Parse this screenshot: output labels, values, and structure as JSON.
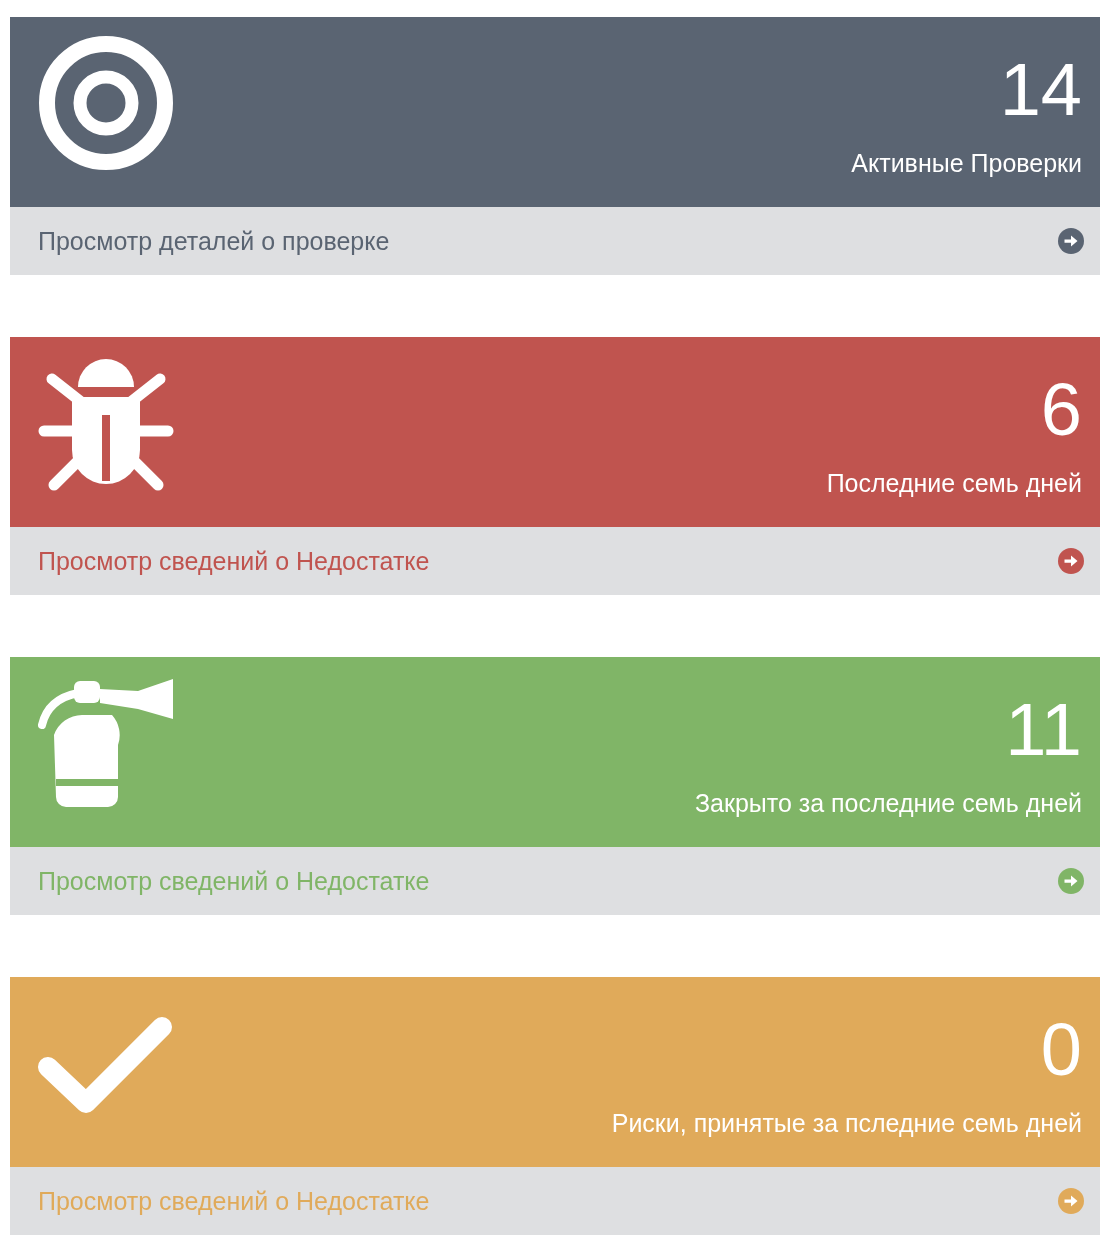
{
  "panels": [
    {
      "kind": "target",
      "color": "#5a6472",
      "count": "14",
      "label": "Активные Проверки",
      "link": "Просмотр деталей о проверке"
    },
    {
      "kind": "bug",
      "color": "#c0544f",
      "count": "6",
      "label": "Последние семь дней",
      "link": "Просмотр сведений о Недостатке"
    },
    {
      "kind": "extinguisher",
      "color": "#80b567",
      "count": "11",
      "label": "Закрыто за последние семь дней",
      "link": "Просмотр сведений о Недостатке"
    },
    {
      "kind": "check",
      "color": "#e0aa5a",
      "count": "0",
      "label": "Риски, принятые за пследние семь дней",
      "link": "Просмотр сведений о Недостатке"
    }
  ]
}
